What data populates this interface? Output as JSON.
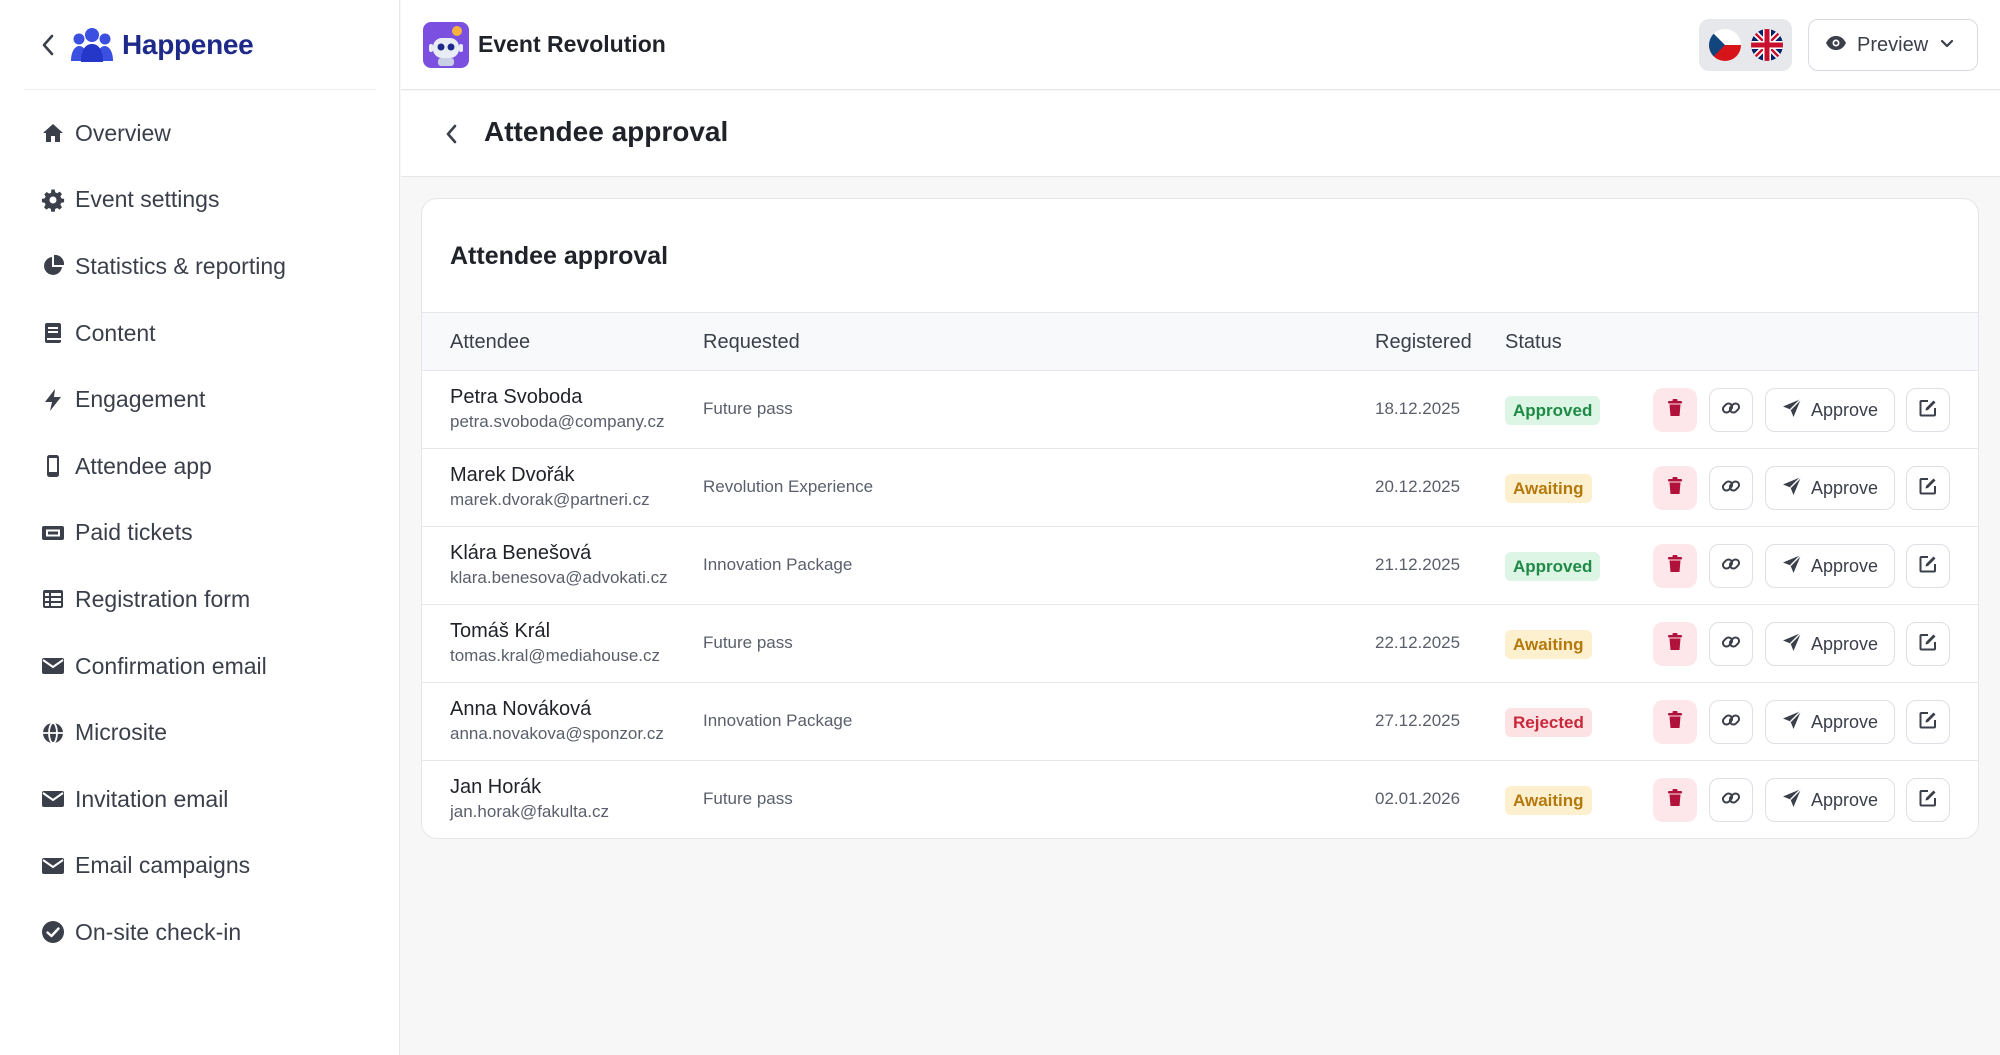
{
  "brand": {
    "name": "Happenee"
  },
  "sidebar": {
    "items": [
      {
        "label": "Overview",
        "icon": "home-icon"
      },
      {
        "label": "Event settings",
        "icon": "gear-icon"
      },
      {
        "label": "Statistics & reporting",
        "icon": "pie-chart-icon"
      },
      {
        "label": "Content",
        "icon": "book-icon"
      },
      {
        "label": "Engagement",
        "icon": "bolt-icon"
      },
      {
        "label": "Attendee app",
        "icon": "mobile-icon"
      },
      {
        "label": "Paid tickets",
        "icon": "ticket-icon"
      },
      {
        "label": "Registration form",
        "icon": "table-icon"
      },
      {
        "label": "Confirmation email",
        "icon": "envelope-icon"
      },
      {
        "label": "Microsite",
        "icon": "globe-icon"
      },
      {
        "label": "Invitation email",
        "icon": "envelope-icon"
      },
      {
        "label": "Email campaigns",
        "icon": "envelope-icon"
      },
      {
        "label": "On-site check-in",
        "icon": "check-circle-icon"
      }
    ]
  },
  "header": {
    "event_title": "Event Revolution",
    "languages": [
      "cz",
      "en"
    ],
    "preview_label": "Preview"
  },
  "page": {
    "title": "Attendee approval"
  },
  "card": {
    "title": "Attendee approval",
    "columns": {
      "attendee": "Attendee",
      "requested": "Requested",
      "registered": "Registered",
      "status": "Status"
    },
    "approve_label": "Approve",
    "rows": [
      {
        "name": "Petra Svoboda",
        "email": "petra.svoboda@company.cz",
        "requested": "Future pass",
        "registered": "18.12.2025",
        "status": "Approved",
        "status_type": "approved"
      },
      {
        "name": "Marek Dvořák",
        "email": "marek.dvorak@partneri.cz",
        "requested": "Revolution Experience",
        "registered": "20.12.2025",
        "status": "Awaiting",
        "status_type": "awaiting"
      },
      {
        "name": "Klára Benešová",
        "email": "klara.benesova@advokati.cz",
        "requested": "Innovation Package",
        "registered": "21.12.2025",
        "status": "Approved",
        "status_type": "approved"
      },
      {
        "name": "Tomáš Král",
        "email": "tomas.kral@mediahouse.cz",
        "requested": "Future pass",
        "registered": "22.12.2025",
        "status": "Awaiting",
        "status_type": "awaiting"
      },
      {
        "name": "Anna Nováková",
        "email": "anna.novakova@sponzor.cz",
        "requested": "Innovation Package",
        "registered": "27.12.2025",
        "status": "Rejected",
        "status_type": "rejected"
      },
      {
        "name": "Jan Horák",
        "email": "jan.horak@fakulta.cz",
        "requested": "Future pass",
        "registered": "02.01.2026",
        "status": "Awaiting",
        "status_type": "awaiting"
      }
    ]
  },
  "colors": {
    "brand": "#1e2a8a",
    "approved": "#1f8a46",
    "awaiting": "#b5790b",
    "rejected": "#c8283b",
    "delete": "#b1123b"
  }
}
